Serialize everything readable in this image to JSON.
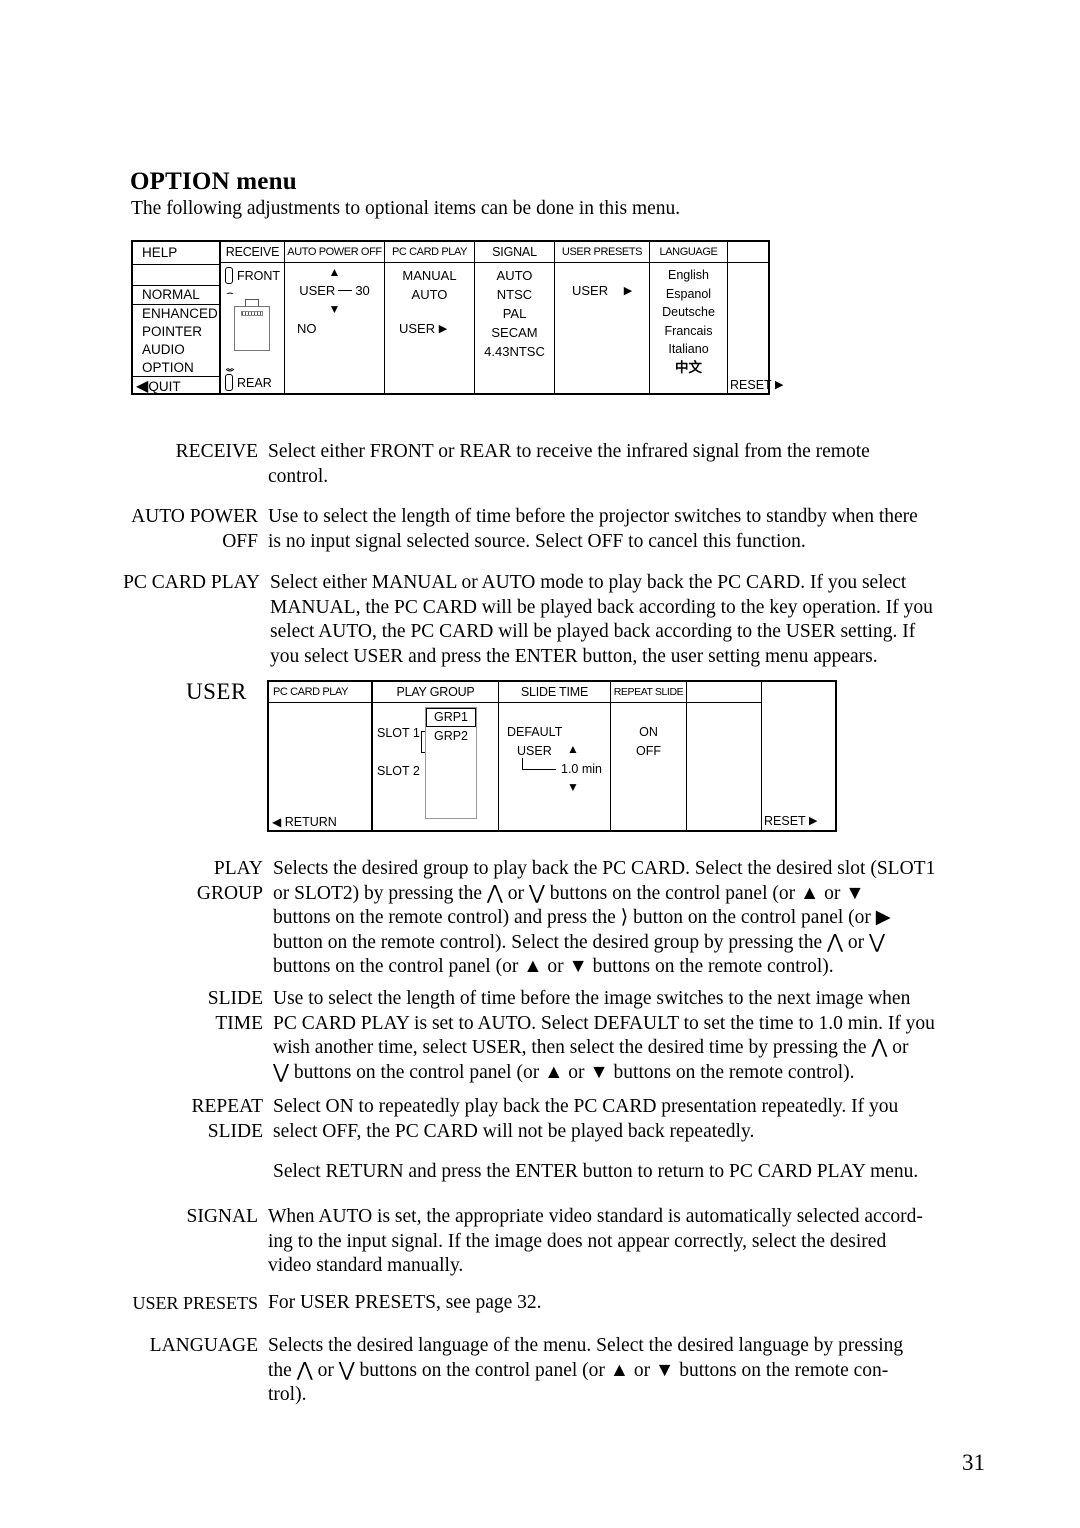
{
  "section": {
    "title_bold": "OPTION",
    "title_rest": " menu",
    "intro": "The following adjustments to optional items can be done in this menu."
  },
  "option_menu": {
    "help_column": {
      "header": "HELP",
      "items": [
        "NORMAL",
        "ENHANCED",
        "POINTER",
        "AUDIO",
        "OPTION"
      ],
      "quit": "QUIT",
      "quit_arrow": "◀"
    },
    "receive_column": {
      "header": "RECEIVE",
      "front": "FRONT",
      "rear": "REAR",
      "front_icon": "ir-sensor-front-icon",
      "rear_icon": "ir-sensor-rear-icon",
      "projector_icon": "projector-illustration-icon"
    },
    "auto_power_off_column": {
      "header": "AUTO POWER OFF",
      "up_arrow": "▲",
      "down_arrow": "▼",
      "user_label": "USER",
      "user_value": "30",
      "no_label": "NO"
    },
    "pc_card_play_column": {
      "header": "PC CARD PLAY",
      "items": [
        "MANUAL",
        "AUTO"
      ],
      "user_label": "USER",
      "user_arrow": "▶"
    },
    "signal_column": {
      "header": "SIGNAL",
      "items": [
        "AUTO",
        "NTSC",
        "PAL",
        "SECAM",
        "4.43NTSC"
      ]
    },
    "user_presets_column": {
      "header": "USER PRESETS",
      "user_label": "USER",
      "user_arrow": "▶"
    },
    "language_column": {
      "header": "LANGUAGE",
      "items": [
        "English",
        "Espanol",
        "Deutsche",
        "Francais",
        "Italiano"
      ],
      "cjk_item": "中文"
    },
    "reset_column": {
      "reset_label": "RESET",
      "reset_arrow": "▶"
    }
  },
  "user_menu": {
    "side_label": "USER",
    "pc_card_play_column": {
      "header": "PC CARD PLAY",
      "return_arrow": "◀",
      "return_label": "RETURN"
    },
    "play_group_column": {
      "header": "PLAY GROUP",
      "slots": [
        "SLOT 1",
        "SLOT 2"
      ],
      "groups": [
        "GRP1",
        "GRP2"
      ]
    },
    "slide_time_column": {
      "header": "SLIDE TIME",
      "default_label": "DEFAULT",
      "user_label": "USER",
      "up_arrow": "▲",
      "down_arrow": "▼",
      "value": "1.0 min"
    },
    "repeat_slide_column": {
      "header": "REPEAT SLIDE",
      "items": [
        "ON",
        "OFF"
      ]
    },
    "reset_column": {
      "reset_label": "RESET",
      "reset_arrow": "▶"
    }
  },
  "definitions": [
    {
      "term": "RECEIVE",
      "lines": [
        "Select either FRONT or REAR to receive the infrared signal from the remote",
        "control."
      ]
    },
    {
      "term": "AUTO POWER\nOFF",
      "lines": [
        "Use to select the length of time before the projector switches to standby when there",
        "is no input signal selected source. Select OFF to cancel this function."
      ]
    },
    {
      "term": "PC CARD PLAY",
      "lines": [
        "Select either MANUAL or AUTO mode to play back the PC CARD. If you select",
        "MANUAL, the PC CARD will be played back according to the key operation. If you",
        "select AUTO, the PC CARD will be played back according to the USER setting. If",
        "you select USER and press the ENTER button, the user setting menu appears."
      ]
    }
  ],
  "definitions_lower": [
    {
      "term": "PLAY\nGROUP",
      "lines": [
        "Selects the desired group to play back the PC CARD. Select the desired slot (SLOT1",
        "or SLOT2) by pressing the ⋀ or ⋁ buttons on the control panel (or ▲ or ▼",
        "buttons on the remote control) and press the ⟩ button on the control panel (or ▶",
        "button on the remote control). Select the desired group by pressing the ⋀ or ⋁",
        "buttons on the control panel (or ▲ or ▼ buttons on the remote control)."
      ]
    },
    {
      "term": "SLIDE\nTIME",
      "lines": [
        "Use to select the length of time before the image switches to the next image when",
        "PC CARD PLAY is set to AUTO. Select DEFAULT to set the time to 1.0 min. If you",
        "wish another time, select USER, then select the desired time by pressing the ⋀ or",
        "⋁ buttons on the control panel (or ▲ or ▼ buttons on the remote control)."
      ]
    },
    {
      "term": "REPEAT\nSLIDE",
      "lines": [
        "Select ON to repeatedly play back the PC CARD presentation repeatedly. If you",
        "select OFF, the PC CARD will not be played back repeatedly."
      ]
    }
  ],
  "return_note": "Select RETURN and press the ENTER button to return to PC CARD PLAY menu.",
  "definitions_tail": [
    {
      "term": "SIGNAL",
      "lines": [
        "When AUTO is set, the appropriate video standard is automatically selected accord-",
        "ing to the input signal. If the image does not appear correctly, select the desired",
        "video standard manually."
      ]
    },
    {
      "term": "USER PRESETS",
      "lines": [
        "For USER PRESETS, see page 32."
      ]
    },
    {
      "term": "LANGUAGE",
      "lines": [
        "Selects the desired language of the menu. Select the desired language by pressing",
        "the ⋀ or ⋁ buttons on the control panel (or ▲ or ▼ buttons on the remote con-",
        "trol)."
      ]
    }
  ],
  "page_number": "31"
}
